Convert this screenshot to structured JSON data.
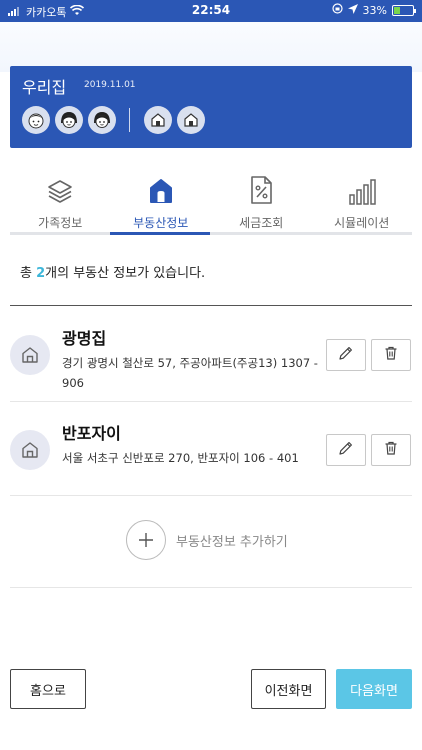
{
  "statusbar": {
    "carrier": "카카오톡",
    "time": "22:54",
    "battery": "33%"
  },
  "card": {
    "title": "우리집",
    "date": "2019.11.01",
    "person_avatars": [
      "boy",
      "girl",
      "girl"
    ],
    "house_avatars": [
      "house",
      "house"
    ]
  },
  "tabs": [
    {
      "label": "가족정보",
      "icon": "layers-icon",
      "active": false
    },
    {
      "label": "부동산정보",
      "icon": "house-icon",
      "active": true
    },
    {
      "label": "세금조회",
      "icon": "percent-doc-icon",
      "active": false
    },
    {
      "label": "시뮬레이션",
      "icon": "bar-chart-icon",
      "active": false
    }
  ],
  "summary": {
    "prefix": "총 ",
    "count": "2",
    "suffix": "개의 부동산 정보가 있습니다."
  },
  "properties": [
    {
      "name": "광명집",
      "address": "경기 광명시 철산로 57, 주공아파트(주공13) 1307 - 906"
    },
    {
      "name": "반포자이",
      "address": "서울 서초구 신반포로 270, 반포자이 106 - 401"
    }
  ],
  "add": {
    "label": "부동산정보 추가하기"
  },
  "buttons": {
    "home": "홈으로",
    "prev": "이전화면",
    "next": "다음화면"
  },
  "colors": {
    "primary": "#2b57b5",
    "accent": "#5bc6e6",
    "count": "#3cb6d9"
  }
}
